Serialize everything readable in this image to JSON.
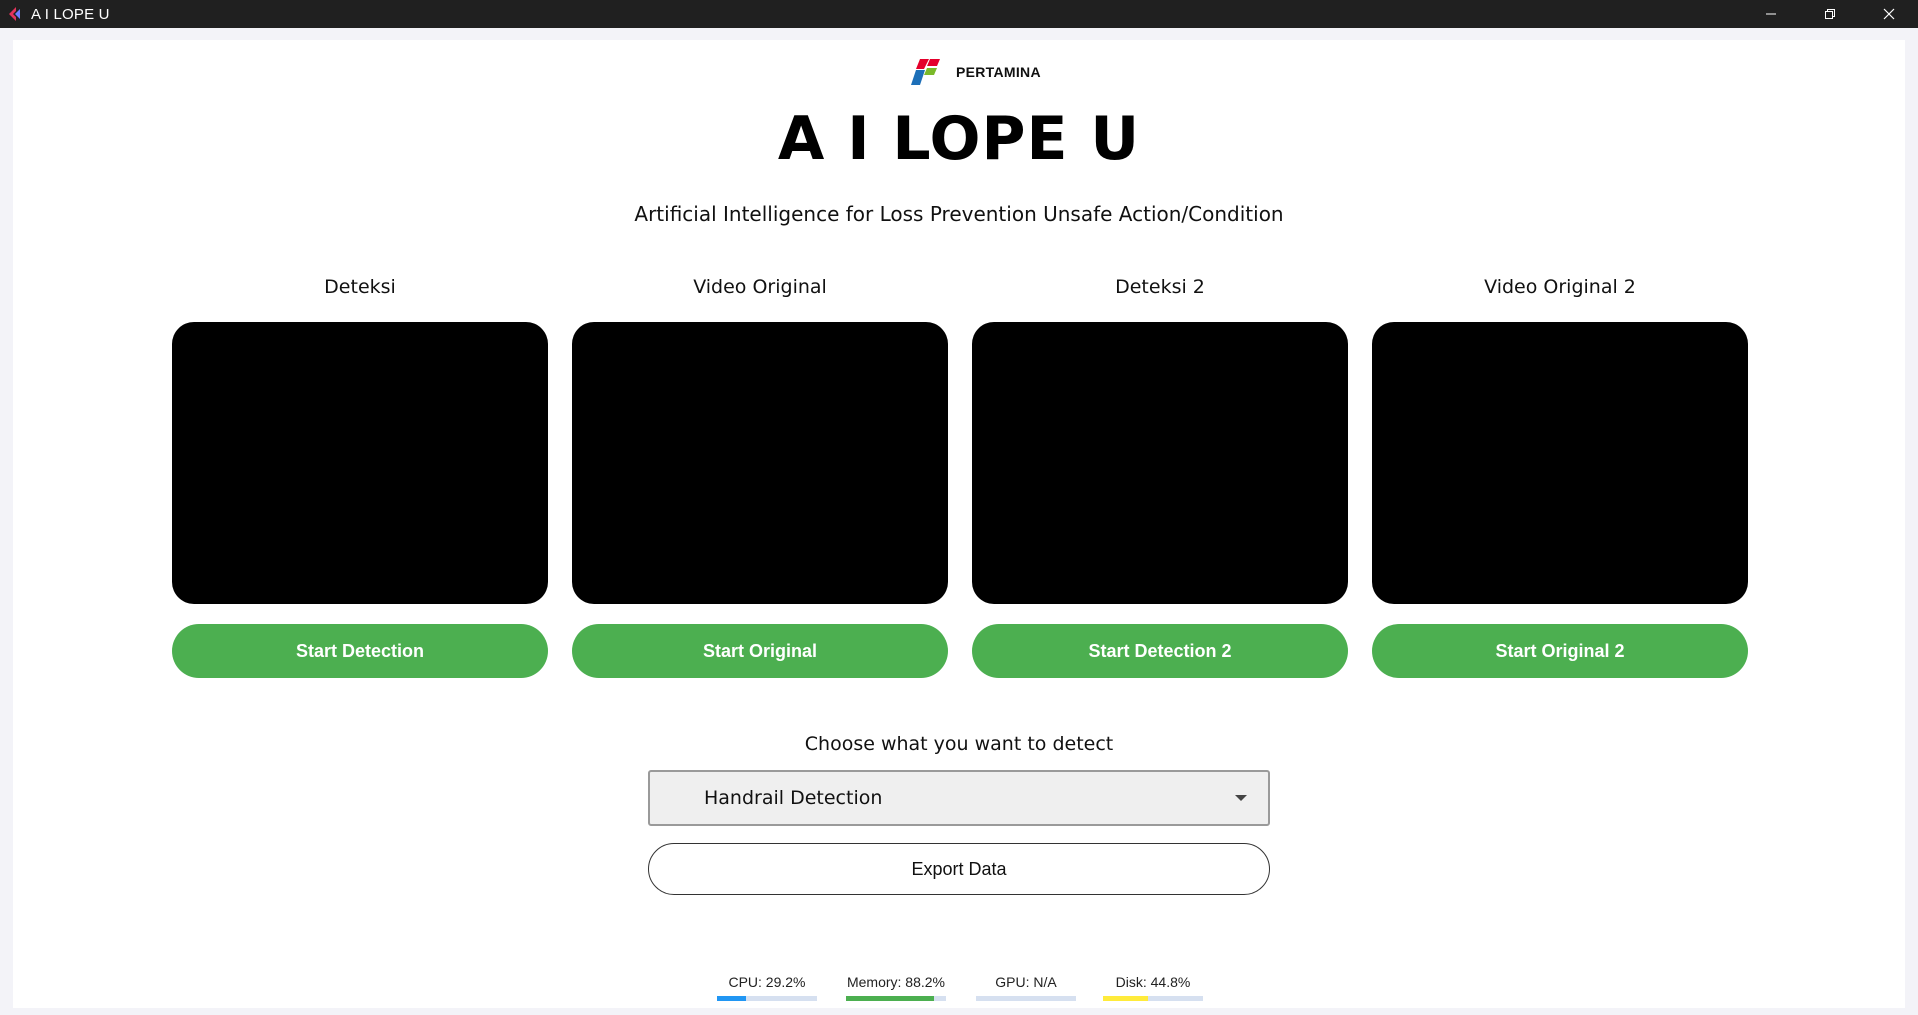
{
  "window": {
    "title": "A I LOPE U",
    "controls": [
      "minimize-icon",
      "restore-icon",
      "close-icon"
    ]
  },
  "header": {
    "logo_text": "PERTAMINA",
    "title": "A I LOPE U",
    "subtitle": "Artificial Intelligence for Loss Prevention Unsafe Action/Condition"
  },
  "panels": [
    {
      "label": "Deteksi",
      "button": "Start Detection"
    },
    {
      "label": "Video Original",
      "button": "Start Original"
    },
    {
      "label": "Deteksi 2",
      "button": "Start Detection 2"
    },
    {
      "label": "Video Original 2",
      "button": "Start Original 2"
    }
  ],
  "detect": {
    "label": "Choose what you want to detect",
    "selected": "Handrail Detection",
    "export_label": "Export Data"
  },
  "stats": [
    {
      "label": "CPU: 29.2%",
      "value": 29.2,
      "color": "#2196f3"
    },
    {
      "label": "Memory: 88.2%",
      "value": 88.2,
      "color": "#4caf50"
    },
    {
      "label": "GPU: N/A",
      "value": 0,
      "color": "#9e9e9e"
    },
    {
      "label": "Disk: 44.8%",
      "value": 44.8,
      "color": "#ffeb3b"
    }
  ],
  "colors": {
    "button_green": "#4caf50",
    "titlebar": "#202020",
    "brand_red": "#e4002b",
    "brand_blue": "#1d6fb8",
    "brand_green": "#7ab929"
  }
}
